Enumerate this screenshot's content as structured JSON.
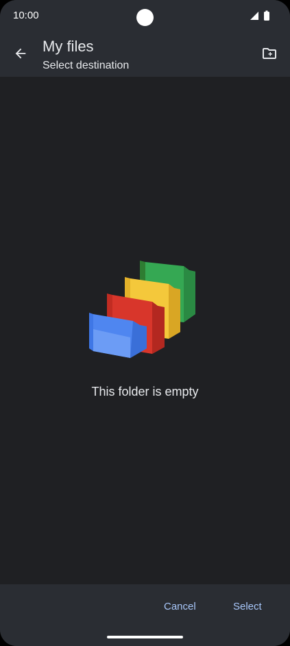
{
  "status_bar": {
    "time": "10:00",
    "icons": [
      "camera-cutout",
      "wifi-icon",
      "battery-icon"
    ]
  },
  "app_bar": {
    "title": "My files",
    "subtitle": "Select destination",
    "back_icon": "arrow-left-icon",
    "action_icon": "create-new-folder-icon"
  },
  "content": {
    "empty_text": "This folder is empty",
    "illustration": "stacked-folders-illustration"
  },
  "actions": {
    "cancel_label": "Cancel",
    "select_label": "Select"
  },
  "colors": {
    "background": "#1f2023",
    "bar_background": "#2a2d33",
    "text_primary": "#e8eaed",
    "accent": "#a8c7fa",
    "folder_blue": "#4f86f0",
    "folder_red": "#d8362b",
    "folder_yellow": "#f4c83b",
    "folder_green": "#35a853"
  }
}
